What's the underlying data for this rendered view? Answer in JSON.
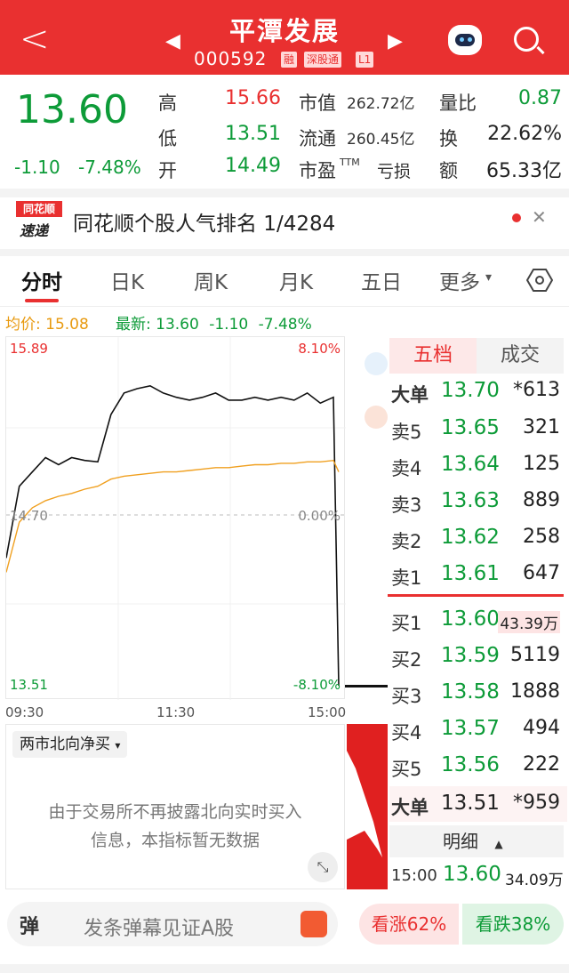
{
  "header": {
    "back_icon": "chevron-left-icon",
    "title": "平潭发展",
    "code": "000592",
    "tags": [
      "融",
      "深股通",
      "L1"
    ],
    "prev_icon": "triangle-left-icon",
    "next_icon": "triangle-right-icon",
    "robot_icon": "robot-icon",
    "search_icon": "search-icon"
  },
  "quote": {
    "price": "13.60",
    "change": "-1.10",
    "change_pct": "-7.48%",
    "high_label": "高",
    "high": "15.66",
    "low_label": "低",
    "low": "13.51",
    "open_label": "开",
    "open": "14.49",
    "mktcap_label": "市值",
    "mktcap": "262.72亿",
    "float_label": "流通",
    "float": "260.45亿",
    "pe_label": "市盈",
    "pe_sup": "TTM",
    "pe": "亏损",
    "volratio_label": "量比",
    "volratio": "0.87",
    "turnover_label": "换",
    "turnover": "22.62%",
    "amount_label": "额",
    "amount": "65.33亿"
  },
  "rank": {
    "logo_top": "同花顺",
    "logo_bottom": "速递",
    "text": "同花顺个股人气排名 1/4284",
    "close_icon": "close-icon"
  },
  "tabs": [
    "分时",
    "日K",
    "周K",
    "月K",
    "五日",
    "更多"
  ],
  "more_caret": "▾",
  "settings_icon": "hexagon-settings-icon",
  "chart_header": {
    "avg_label": "均价:",
    "avg": "15.08",
    "latest_label": "最新:",
    "latest": "13.60",
    "chg": "-1.10",
    "chg_pct": "-7.48%"
  },
  "chart_data": {
    "type": "line",
    "y_top": "15.89",
    "y_mid": "14.70",
    "y_bot": "13.51",
    "pct_top": "8.10%",
    "pct_mid": "0.00%",
    "pct_bot": "-8.10%",
    "x_labels": [
      "09:30",
      "11:30",
      "15:00"
    ],
    "ylim": [
      13.51,
      15.89
    ],
    "series": [
      {
        "values": [
          14.4,
          14.9,
          15.0,
          15.1,
          15.05,
          15.1,
          15.08,
          15.07,
          15.4,
          15.55,
          15.58,
          15.6,
          15.55,
          15.52,
          15.5,
          15.52,
          15.55,
          15.5,
          15.5,
          15.52,
          15.5,
          15.52,
          15.5,
          15.55,
          15.48,
          15.52,
          13.51
        ]
      },
      {
        "values": [
          14.3,
          14.65,
          14.75,
          14.8,
          14.83,
          14.85,
          14.88,
          14.9,
          14.95,
          14.97,
          14.98,
          14.99,
          15.0,
          15.0,
          15.01,
          15.02,
          15.03,
          15.03,
          15.04,
          15.05,
          15.05,
          15.06,
          15.06,
          15.07,
          15.07,
          15.08,
          15.0
        ]
      }
    ]
  },
  "northbound": {
    "label": "两市北向净买",
    "caret": "▾",
    "msg1": "由于交易所不再披露北向实时买入",
    "msg2": "信息，本指标暂无数据",
    "expand_icon": "expand-icon"
  },
  "orderbook": {
    "tab_five": "五档",
    "tab_deal": "成交",
    "big_sell": {
      "label": "大单",
      "price": "13.70",
      "vol": "*613"
    },
    "asks": [
      {
        "label": "卖5",
        "price": "13.65",
        "vol": "321"
      },
      {
        "label": "卖4",
        "price": "13.64",
        "vol": "125"
      },
      {
        "label": "卖3",
        "price": "13.63",
        "vol": "889"
      },
      {
        "label": "卖2",
        "price": "13.62",
        "vol": "258"
      },
      {
        "label": "卖1",
        "price": "13.61",
        "vol": "647"
      }
    ],
    "bids": [
      {
        "label": "买1",
        "price": "13.60",
        "vol": "43.39万"
      },
      {
        "label": "买2",
        "price": "13.59",
        "vol": "5119"
      },
      {
        "label": "买3",
        "price": "13.58",
        "vol": "1888"
      },
      {
        "label": "买4",
        "price": "13.57",
        "vol": "494"
      },
      {
        "label": "买5",
        "price": "13.56",
        "vol": "222"
      }
    ],
    "big_buy": {
      "label": "大单",
      "price": "13.51",
      "vol": "*959"
    },
    "detail_label": "明细",
    "detail_caret": "▲",
    "trade": {
      "time": "15:00",
      "price": "13.60",
      "vol": "34.09万"
    }
  },
  "bottom": {
    "danmu_icon": "弹",
    "danmu_text": "发条弹幕见证A股",
    "gift_icon": "gift-icon",
    "up_label": "看涨",
    "up_pct": "62%",
    "down_label": "看跌",
    "down_pct": "38%"
  },
  "colors": {
    "red": "#e93030",
    "green": "#0d9b38",
    "avg_line": "#f0a020"
  }
}
